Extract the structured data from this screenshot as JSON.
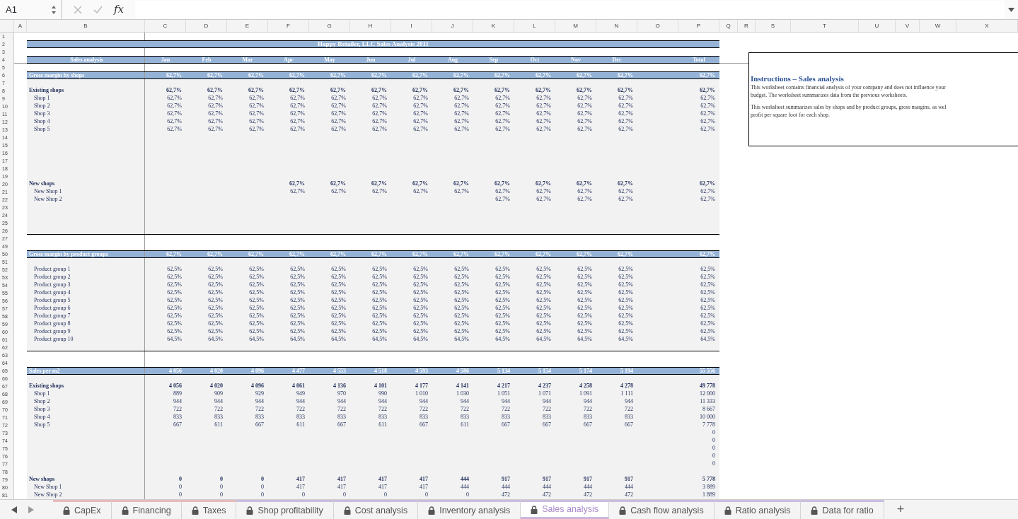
{
  "formula_bar": {
    "cell": "A1",
    "fx": "fx"
  },
  "columns": [
    "A",
    "B",
    "C",
    "D",
    "E",
    "F",
    "G",
    "H",
    "I",
    "J",
    "K",
    "L",
    "M",
    "N",
    "O",
    "P",
    "Q",
    "R",
    "S",
    "T",
    "U",
    "V",
    "W",
    "X"
  ],
  "rows": [
    {
      "num": "1",
      "kind": "blank"
    },
    {
      "num": "2",
      "kind": "title",
      "title": "Happy Retailer, LLC Sales Analysis 2011"
    },
    {
      "num": "3",
      "kind": "blank"
    },
    {
      "num": "4",
      "kind": "columns",
      "label": "Sales analysis",
      "values": {
        "jan": "Jan",
        "feb": "Feb",
        "mar": "Mar",
        "apr": "Apr",
        "may": "May",
        "jun": "Jun",
        "jul": "Jul",
        "aug": "Aug",
        "sep": "Sep",
        "oct": "Oct",
        "nov": "Nov",
        "dec": "Dec",
        "total": "Total"
      }
    },
    {
      "num": "5",
      "kind": "blank"
    },
    {
      "num": "6",
      "kind": "band",
      "label": "Gross margin by shops",
      "values": {
        "jan": "62,7%",
        "feb": "62,7%",
        "mar": "62,7%",
        "apr": "62,7%",
        "may": "62,7%",
        "jun": "62,7%",
        "jul": "62,7%",
        "aug": "62,7%",
        "sep": "62,7%",
        "oct": "62,7%",
        "nov": "62,7%",
        "dec": "62,7%",
        "total": "62,7%"
      }
    },
    {
      "num": "7",
      "kind": "gap"
    },
    {
      "num": "8",
      "kind": "group",
      "label": "Existing shops",
      "values": {
        "jan": "62,7%",
        "feb": "62,7%",
        "mar": "62,7%",
        "apr": "62,7%",
        "may": "62,7%",
        "jun": "62,7%",
        "jul": "62,7%",
        "aug": "62,7%",
        "sep": "62,7%",
        "oct": "62,7%",
        "nov": "62,7%",
        "dec": "62,7%",
        "total": "62,7%"
      }
    },
    {
      "num": "9",
      "kind": "item",
      "label": "Shop 1",
      "values": {
        "jan": "62,7%",
        "feb": "62,7%",
        "mar": "62,7%",
        "apr": "62,7%",
        "may": "62,7%",
        "jun": "62,7%",
        "jul": "62,7%",
        "aug": "62,7%",
        "sep": "62,7%",
        "oct": "62,7%",
        "nov": "62,7%",
        "dec": "62,7%",
        "total": "62,7%"
      }
    },
    {
      "num": "10",
      "kind": "item",
      "label": "Shop 2",
      "values": {
        "jan": "62,7%",
        "feb": "62,7%",
        "mar": "62,7%",
        "apr": "62,7%",
        "may": "62,7%",
        "jun": "62,7%",
        "jul": "62,7%",
        "aug": "62,7%",
        "sep": "62,7%",
        "oct": "62,7%",
        "nov": "62,7%",
        "dec": "62,7%",
        "total": "62,7%"
      }
    },
    {
      "num": "11",
      "kind": "item",
      "label": "Shop 3",
      "values": {
        "jan": "62,7%",
        "feb": "62,7%",
        "mar": "62,7%",
        "apr": "62,7%",
        "may": "62,7%",
        "jun": "62,7%",
        "jul": "62,7%",
        "aug": "62,7%",
        "sep": "62,7%",
        "oct": "62,7%",
        "nov": "62,7%",
        "dec": "62,7%",
        "total": "62,7%"
      }
    },
    {
      "num": "12",
      "kind": "item",
      "label": "Shop 4",
      "values": {
        "jan": "62,7%",
        "feb": "62,7%",
        "mar": "62,7%",
        "apr": "62,7%",
        "may": "62,7%",
        "jun": "62,7%",
        "jul": "62,7%",
        "aug": "62,7%",
        "sep": "62,7%",
        "oct": "62,7%",
        "nov": "62,7%",
        "dec": "62,7%",
        "total": "62,7%"
      }
    },
    {
      "num": "13",
      "kind": "item",
      "label": "Shop 5",
      "values": {
        "jan": "62,7%",
        "feb": "62,7%",
        "mar": "62,7%",
        "apr": "62,7%",
        "may": "62,7%",
        "jun": "62,7%",
        "jul": "62,7%",
        "aug": "62,7%",
        "sep": "62,7%",
        "oct": "62,7%",
        "nov": "62,7%",
        "dec": "62,7%",
        "total": "62,7%"
      }
    },
    {
      "num": "14",
      "kind": "gap"
    },
    {
      "num": "15",
      "kind": "gap"
    },
    {
      "num": "16",
      "kind": "gap"
    },
    {
      "num": "17",
      "kind": "gap"
    },
    {
      "num": "18",
      "kind": "gap"
    },
    {
      "num": "19",
      "kind": "gap"
    },
    {
      "num": "20",
      "kind": "group",
      "label": "New shops",
      "values": {
        "apr": "62,7%",
        "may": "62,7%",
        "jun": "62,7%",
        "jul": "62,7%",
        "aug": "62,7%",
        "sep": "62,7%",
        "oct": "62,7%",
        "nov": "62,7%",
        "dec": "62,7%",
        "total": "62,7%"
      }
    },
    {
      "num": "21",
      "kind": "item",
      "label": "New Shop 1",
      "values": {
        "apr": "62,7%",
        "may": "62,7%",
        "jun": "62,7%",
        "jul": "62,7%",
        "aug": "62,7%",
        "sep": "62,7%",
        "oct": "62,7%",
        "nov": "62,7%",
        "dec": "62,7%",
        "total": "62,7%"
      }
    },
    {
      "num": "22",
      "kind": "item",
      "label": "New Shop 2",
      "values": {
        "sep": "62,7%",
        "oct": "62,7%",
        "nov": "62,7%",
        "dec": "62,7%",
        "total": "62,7%"
      }
    },
    {
      "num": "23",
      "kind": "gap"
    },
    {
      "num": "24",
      "kind": "gap"
    },
    {
      "num": "25",
      "kind": "gap"
    },
    {
      "num": "26",
      "kind": "gap"
    },
    {
      "num": "27",
      "kind": "blank"
    },
    {
      "num": "49",
      "kind": "blank"
    },
    {
      "num": "50",
      "kind": "band",
      "label": "Gross margin by product groups",
      "values": {
        "jan": "62,7%",
        "feb": "62,7%",
        "mar": "62,7%",
        "apr": "62,7%",
        "may": "62,7%",
        "jun": "62,7%",
        "jul": "62,7%",
        "aug": "62,7%",
        "sep": "62,7%",
        "oct": "62,7%",
        "nov": "62,7%",
        "dec": "62,7%",
        "total": "62,7%"
      }
    },
    {
      "num": "51",
      "kind": "gap"
    },
    {
      "num": "52",
      "kind": "item",
      "label": "Product group 1",
      "values": {
        "jan": "62,5%",
        "feb": "62,5%",
        "mar": "62,5%",
        "apr": "62,5%",
        "may": "62,5%",
        "jun": "62,5%",
        "jul": "62,5%",
        "aug": "62,5%",
        "sep": "62,5%",
        "oct": "62,5%",
        "nov": "62,5%",
        "dec": "62,5%",
        "total": "62,5%"
      }
    },
    {
      "num": "53",
      "kind": "item",
      "label": "Product group 2",
      "values": {
        "jan": "62,5%",
        "feb": "62,5%",
        "mar": "62,5%",
        "apr": "62,5%",
        "may": "62,5%",
        "jun": "62,5%",
        "jul": "62,5%",
        "aug": "62,5%",
        "sep": "62,5%",
        "oct": "62,5%",
        "nov": "62,5%",
        "dec": "62,5%",
        "total": "62,5%"
      }
    },
    {
      "num": "54",
      "kind": "item",
      "label": "Product group 3",
      "values": {
        "jan": "62,5%",
        "feb": "62,5%",
        "mar": "62,5%",
        "apr": "62,5%",
        "may": "62,5%",
        "jun": "62,5%",
        "jul": "62,5%",
        "aug": "62,5%",
        "sep": "62,5%",
        "oct": "62,5%",
        "nov": "62,5%",
        "dec": "62,5%",
        "total": "62,5%"
      }
    },
    {
      "num": "55",
      "kind": "item",
      "label": "Product group 4",
      "values": {
        "jan": "62,5%",
        "feb": "62,5%",
        "mar": "62,5%",
        "apr": "62,5%",
        "may": "62,5%",
        "jun": "62,5%",
        "jul": "62,5%",
        "aug": "62,5%",
        "sep": "62,5%",
        "oct": "62,5%",
        "nov": "62,5%",
        "dec": "62,5%",
        "total": "62,5%"
      }
    },
    {
      "num": "56",
      "kind": "item",
      "label": "Product group 5",
      "values": {
        "jan": "62,5%",
        "feb": "62,5%",
        "mar": "62,5%",
        "apr": "62,5%",
        "may": "62,5%",
        "jun": "62,5%",
        "jul": "62,5%",
        "aug": "62,5%",
        "sep": "62,5%",
        "oct": "62,5%",
        "nov": "62,5%",
        "dec": "62,5%",
        "total": "62,5%"
      }
    },
    {
      "num": "57",
      "kind": "item",
      "label": "Product group 6",
      "values": {
        "jan": "62,5%",
        "feb": "62,5%",
        "mar": "62,5%",
        "apr": "62,5%",
        "may": "62,5%",
        "jun": "62,5%",
        "jul": "62,5%",
        "aug": "62,5%",
        "sep": "62,5%",
        "oct": "62,5%",
        "nov": "62,5%",
        "dec": "62,5%",
        "total": "62,5%"
      }
    },
    {
      "num": "58",
      "kind": "item",
      "label": "Product group 7",
      "values": {
        "jan": "62,5%",
        "feb": "62,5%",
        "mar": "62,5%",
        "apr": "62,5%",
        "may": "62,5%",
        "jun": "62,5%",
        "jul": "62,5%",
        "aug": "62,5%",
        "sep": "62,5%",
        "oct": "62,5%",
        "nov": "62,5%",
        "dec": "62,5%",
        "total": "62,5%"
      }
    },
    {
      "num": "59",
      "kind": "item",
      "label": "Product group 8",
      "values": {
        "jan": "62,5%",
        "feb": "62,5%",
        "mar": "62,5%",
        "apr": "62,5%",
        "may": "62,5%",
        "jun": "62,5%",
        "jul": "62,5%",
        "aug": "62,5%",
        "sep": "62,5%",
        "oct": "62,5%",
        "nov": "62,5%",
        "dec": "62,5%",
        "total": "62,5%"
      }
    },
    {
      "num": "60",
      "kind": "item",
      "label": "Product group 9",
      "values": {
        "jan": "62,5%",
        "feb": "62,5%",
        "mar": "62,5%",
        "apr": "62,5%",
        "may": "62,5%",
        "jun": "62,5%",
        "jul": "62,5%",
        "aug": "62,5%",
        "sep": "62,5%",
        "oct": "62,5%",
        "nov": "62,5%",
        "dec": "62,5%",
        "total": "62,5%"
      }
    },
    {
      "num": "61",
      "kind": "item",
      "label": "Product group 10",
      "values": {
        "jan": "64,5%",
        "feb": "64,5%",
        "mar": "64,5%",
        "apr": "64,5%",
        "may": "64,5%",
        "jun": "64,5%",
        "jul": "64,5%",
        "aug": "64,5%",
        "sep": "64,5%",
        "oct": "64,5%",
        "nov": "64,5%",
        "dec": "64,5%",
        "total": "64,5%"
      }
    },
    {
      "num": "62",
      "kind": "gap"
    },
    {
      "num": "63",
      "kind": "blank"
    },
    {
      "num": "64",
      "kind": "blank"
    },
    {
      "num": "65",
      "kind": "band",
      "label": "Sales per m2",
      "values": {
        "jan": "4 056",
        "feb": "4 020",
        "mar": "4 096",
        "apr": "4 477",
        "may": "4 553",
        "jun": "4 518",
        "jul": "4 593",
        "aug": "4 586",
        "sep": "5 134",
        "oct": "5 154",
        "nov": "5 174",
        "dec": "5 194",
        "total": "55 556"
      }
    },
    {
      "num": "66",
      "kind": "gap"
    },
    {
      "num": "67",
      "kind": "group",
      "label": "Existing shops",
      "values": {
        "jan": "4 056",
        "feb": "4 020",
        "mar": "4 096",
        "apr": "4 061",
        "may": "4 136",
        "jun": "4 101",
        "jul": "4 177",
        "aug": "4 141",
        "sep": "4 217",
        "oct": "4 237",
        "nov": "4 258",
        "dec": "4 278",
        "total": "49 778"
      }
    },
    {
      "num": "68",
      "kind": "item",
      "label": "Shop 1",
      "values": {
        "jan": "889",
        "feb": "909",
        "mar": "929",
        "apr": "949",
        "may": "970",
        "jun": "990",
        "jul": "1 010",
        "aug": "1 030",
        "sep": "1 051",
        "oct": "1 071",
        "nov": "1 091",
        "dec": "1 111",
        "total": "12 000"
      }
    },
    {
      "num": "69",
      "kind": "item",
      "label": "Shop 2",
      "values": {
        "jan": "944",
        "feb": "944",
        "mar": "944",
        "apr": "944",
        "may": "944",
        "jun": "944",
        "jul": "944",
        "aug": "944",
        "sep": "944",
        "oct": "944",
        "nov": "944",
        "dec": "944",
        "total": "11 333"
      }
    },
    {
      "num": "70",
      "kind": "item",
      "label": "Shop 3",
      "values": {
        "jan": "722",
        "feb": "722",
        "mar": "722",
        "apr": "722",
        "may": "722",
        "jun": "722",
        "jul": "722",
        "aug": "722",
        "sep": "722",
        "oct": "722",
        "nov": "722",
        "dec": "722",
        "total": "8 667"
      }
    },
    {
      "num": "71",
      "kind": "item",
      "label": "Shop 4",
      "values": {
        "jan": "833",
        "feb": "833",
        "mar": "833",
        "apr": "833",
        "may": "833",
        "jun": "833",
        "jul": "833",
        "aug": "833",
        "sep": "833",
        "oct": "833",
        "nov": "833",
        "dec": "833",
        "total": "10 000"
      }
    },
    {
      "num": "72",
      "kind": "item",
      "label": "Shop 5",
      "values": {
        "jan": "667",
        "feb": "611",
        "mar": "667",
        "apr": "611",
        "may": "667",
        "jun": "611",
        "jul": "667",
        "aug": "611",
        "sep": "667",
        "oct": "667",
        "nov": "667",
        "dec": "667",
        "total": "7 778"
      }
    },
    {
      "num": "73",
      "kind": "item",
      "values": {
        "total": "0"
      }
    },
    {
      "num": "74",
      "kind": "item",
      "values": {
        "total": "0"
      }
    },
    {
      "num": "75",
      "kind": "item",
      "values": {
        "total": "0"
      }
    },
    {
      "num": "76",
      "kind": "item",
      "values": {
        "total": "0"
      }
    },
    {
      "num": "77",
      "kind": "item",
      "values": {
        "total": "0"
      }
    },
    {
      "num": "78",
      "kind": "gap"
    },
    {
      "num": "79",
      "kind": "group",
      "label": "New shops",
      "values": {
        "jan": "0",
        "feb": "0",
        "mar": "0",
        "apr": "417",
        "may": "417",
        "jun": "417",
        "jul": "417",
        "aug": "444",
        "sep": "917",
        "oct": "917",
        "nov": "917",
        "dec": "917",
        "total": "5 778"
      }
    },
    {
      "num": "80",
      "kind": "item",
      "label": "New Shop 1",
      "values": {
        "jan": "0",
        "feb": "0",
        "mar": "0",
        "apr": "417",
        "may": "417",
        "jun": "417",
        "jul": "417",
        "aug": "444",
        "sep": "444",
        "oct": "444",
        "nov": "444",
        "dec": "444",
        "total": "3 889"
      }
    },
    {
      "num": "81",
      "kind": "item",
      "label": "New Shop 2",
      "values": {
        "jan": "0",
        "feb": "0",
        "mar": "0",
        "apr": "0",
        "may": "0",
        "jun": "0",
        "jul": "0",
        "aug": "0",
        "sep": "472",
        "oct": "472",
        "nov": "472",
        "dec": "472",
        "total": "1 889"
      }
    }
  ],
  "instructions": {
    "title": "Instructions – Sales analysis",
    "paragraphs": [
      "This worksheet contains financial analysis of your company and does not influence your\nbudget. The worksheet summarizes data from the previous worksheets.",
      "This worksheet summarizes sales by shops and by product groups, gross margins, as wel\nprofit per square foot for each shop."
    ]
  },
  "tabs": [
    {
      "label": "CapEx",
      "selected": false,
      "color": "#e9b9bd"
    },
    {
      "label": "Financing",
      "selected": false,
      "color": "#e9b9bd"
    },
    {
      "label": "Taxes",
      "selected": false,
      "color": "#e9b9bd"
    },
    {
      "label": "Shop profitability",
      "selected": false,
      "color": "#cbbedf"
    },
    {
      "label": "Cost analysis",
      "selected": false,
      "color": "#cbbedf"
    },
    {
      "label": "Inventory analysis",
      "selected": false,
      "color": "#cbbedf"
    },
    {
      "label": "Sales analysis",
      "selected": true,
      "color": "#cbbedf"
    },
    {
      "label": "Cash flow analysis",
      "selected": false,
      "color": "#cbbedf"
    },
    {
      "label": "Ratio analysis",
      "selected": false,
      "color": "#cbbedf"
    },
    {
      "label": "Data for ratio",
      "selected": false,
      "color": "#cbbedf"
    }
  ],
  "add_sheet": "+"
}
